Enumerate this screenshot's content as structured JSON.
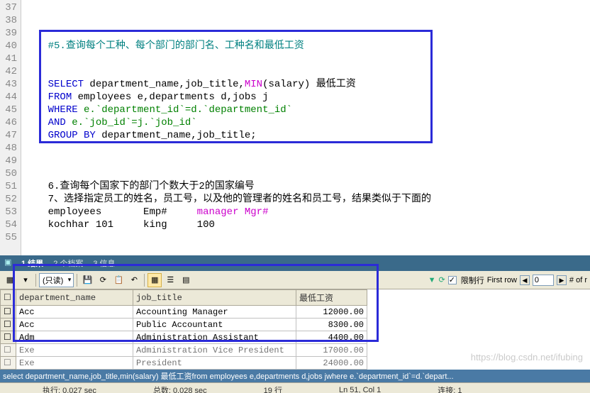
{
  "gutter": [
    "37",
    "38",
    "39",
    "40",
    "41",
    "42",
    "43",
    "44",
    "45",
    "46",
    "47",
    "48",
    "49",
    "50",
    "51",
    "52",
    "53",
    "54",
    "55"
  ],
  "code": {
    "l40_comment": "#5.查询每个工种、每个部门的部门名、工种名和最低工资",
    "l43_select": "SELECT",
    "l43_cols": " department_name,job_title,",
    "l43_min": "MIN",
    "l43_paren": "(salary) ",
    "l43_alias": "最低工资",
    "l44_from": "FROM",
    "l44_rest": " employees e,departments d,jobs j",
    "l45_where": "WHERE",
    "l45_rest": " e.`department_id`=d.`department_id`",
    "l46_and": "AND",
    "l46_rest": " e.`job_id`=j.`job_id`",
    "l47_group": "GROUP BY",
    "l47_rest": " department_name,job_title;",
    "l51": "6.查询每个国家下的部门个数大于2的国家编号",
    "l52": "7、选择指定员工的姓名，员工号，以及他的管理者的姓名和员工号，结果类似于下面的",
    "l53a": "employees",
    "l53b": "Emp#",
    "l53c": "manager Mgr#",
    "l54a": "kochhar 101",
    "l54b": "king",
    "l54c": "100"
  },
  "tabs": {
    "tab1": "1 结果",
    "tab2": "2 个档案",
    "tab3": "3 信息"
  },
  "toolbar": {
    "readonly": "(只读)",
    "limit_label": "限制行",
    "first_row": "First row",
    "first_row_val": "0",
    "of_rows": "# of r"
  },
  "grid": {
    "headers": [
      "department_name",
      "job_title",
      "最低工资"
    ],
    "rows": [
      [
        "Acc",
        "Accounting Manager",
        "12000.00"
      ],
      [
        "Acc",
        "Public Accountant",
        "8300.00"
      ],
      [
        "Adm",
        "Administration Assistant",
        "4400.00"
      ],
      [
        "Exe",
        "Administration Vice President",
        "17000.00"
      ],
      [
        "Exe",
        "President",
        "24000.00"
      ]
    ]
  },
  "status": {
    "sql": "select department_name,job_title,min(salary) 最低工资from employees e,departments d,jobs jwhere e.`department_id`=d.`depart...",
    "exec": "执行: 0.027 sec",
    "total": "总数: 0.028 sec",
    "rows": "19 行",
    "ln": "Ln 51, Col 1",
    "conn": "连接: 1"
  },
  "watermark": "https://blog.csdn.net/ifubing"
}
